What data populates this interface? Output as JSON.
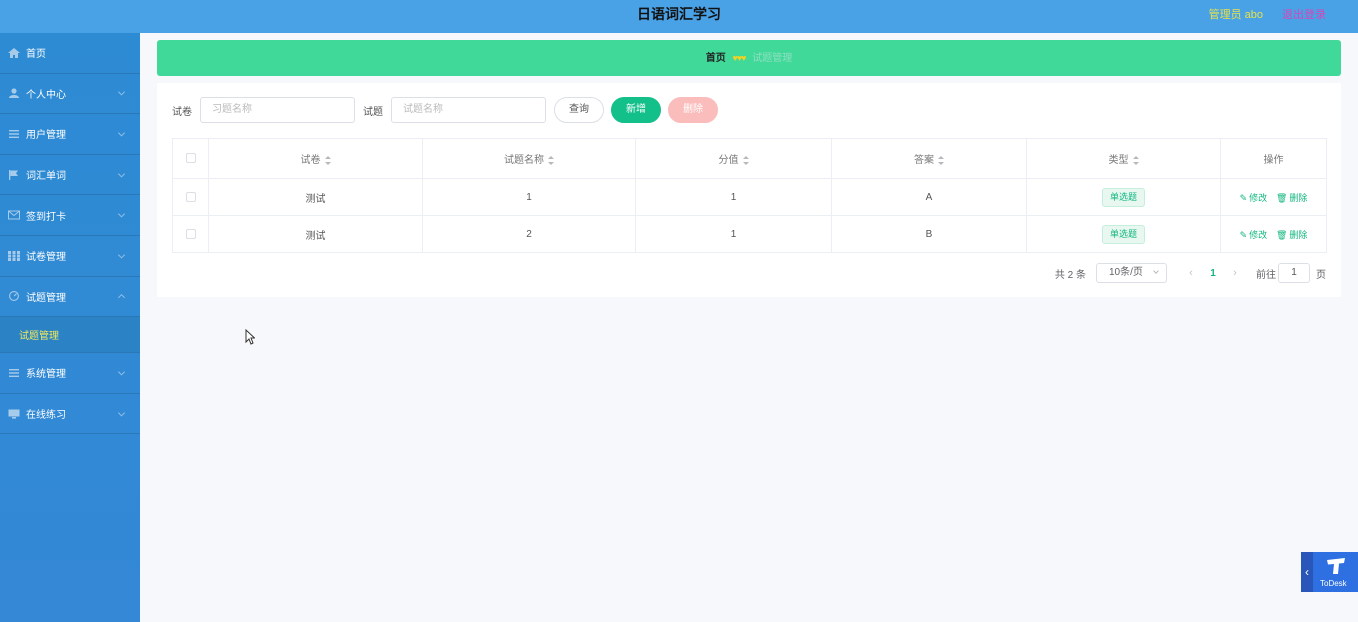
{
  "header": {
    "title": "日语词汇学习",
    "user_label": "管理员 abo",
    "logout_label": "退出登录"
  },
  "sidebar": {
    "items": [
      {
        "label": "首页",
        "icon": "home-icon"
      },
      {
        "label": "个人中心",
        "icon": "user-icon"
      },
      {
        "label": "用户管理",
        "icon": "list-icon"
      },
      {
        "label": "词汇单词",
        "icon": "flag-icon"
      },
      {
        "label": "签到打卡",
        "icon": "mail-icon"
      },
      {
        "label": "试卷管理",
        "icon": "grid-icon"
      },
      {
        "label": "试题管理",
        "icon": "gauge-icon"
      },
      {
        "label": "系统管理",
        "icon": "list-icon"
      },
      {
        "label": "在线练习",
        "icon": "monitor-icon"
      }
    ],
    "sub_active": "试题管理"
  },
  "breadcrumb": {
    "home": "首页",
    "separator": "♥♥♥",
    "current": "试题管理"
  },
  "search": {
    "paper_label": "试卷",
    "paper_placeholder": "习题名称",
    "question_label": "试题",
    "question_placeholder": "试题名称",
    "query_label": "查询",
    "add_label": "新增",
    "delete_label": "删除"
  },
  "table": {
    "headers": [
      "试卷",
      "试题名称",
      "分值",
      "答案",
      "类型",
      "操作"
    ],
    "rows": [
      {
        "paper": "测试",
        "name": "1",
        "score": "1",
        "answer": "A",
        "type": "单选题"
      },
      {
        "paper": "测试",
        "name": "2",
        "score": "1",
        "answer": "B",
        "type": "单选题"
      }
    ],
    "edit_label": "修改",
    "delete_label": "删除"
  },
  "pagination": {
    "total": "共 2 条",
    "page_size": "10条/页",
    "current_page": "1",
    "goto_label": "前往",
    "goto_value": "1",
    "page_unit": "页"
  },
  "todesk": {
    "label": "ToDesk"
  },
  "colors": {
    "header_bg": "#4aa2e6",
    "sidebar_bg": "#2d8bd3",
    "breadcrumb_bg": "#40d99a",
    "accent": "#14c08a",
    "danger_light": "#fbbcbc"
  }
}
